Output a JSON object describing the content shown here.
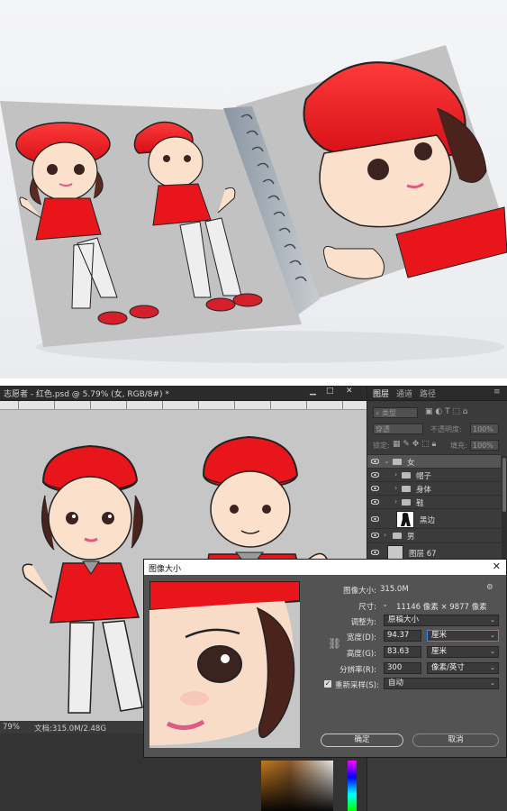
{
  "photoshop": {
    "document_tab": "志愿者 - 红色.psd @ 5.79% (女, RGB/8#) *",
    "status": {
      "zoom": "79%",
      "doc_info": "文档:315.0M/2.48G"
    },
    "panel_tabs": [
      "图层",
      "通道",
      "路径"
    ],
    "layers_panel": {
      "filter_placeholder": "类型",
      "blend_mode": "穿透",
      "opacity_label": "不透明度:",
      "opacity_value": "100%",
      "lock_label": "锁定:",
      "fill_label": "填充:",
      "fill_value": "100%",
      "layers": [
        {
          "name": "女",
          "type": "group",
          "expanded": true,
          "indent": 0
        },
        {
          "name": "帽子",
          "type": "group",
          "expanded": false,
          "indent": 1
        },
        {
          "name": "身体",
          "type": "group",
          "expanded": false,
          "indent": 1
        },
        {
          "name": "鞋",
          "type": "group",
          "expanded": false,
          "indent": 1
        },
        {
          "name": "黑边",
          "type": "layer",
          "indent": 1
        },
        {
          "name": "男",
          "type": "group",
          "expanded": false,
          "indent": 0
        },
        {
          "name": "图层 67",
          "type": "layer",
          "indent": 0
        }
      ]
    },
    "image_size_dialog": {
      "title": "图像大小",
      "close_icon": "close-icon",
      "image_size_label": "图像大小:",
      "image_size_value": "315.0M",
      "dimensions_label": "尺寸:",
      "dimensions_value": "11146 像素 × 9877 像素",
      "fit_label": "调整为:",
      "fit_value": "原稿大小",
      "width_label": "宽度(D):",
      "width_value": "94.37",
      "width_unit": "厘米",
      "height_label": "高度(G):",
      "height_value": "83.63",
      "height_unit": "厘米",
      "resolution_label": "分辨率(R):",
      "resolution_value": "300",
      "resolution_unit": "像素/英寸",
      "resample_label": "重新采样(S):",
      "resample_checked": true,
      "resample_value": "自动",
      "ok_label": "确定",
      "cancel_label": "取消"
    }
  },
  "colors": {
    "cap_red": "#e8151b",
    "shirt_red": "#e8151b",
    "ps_dark": "#3c3c3c",
    "dialog_bg": "#535353"
  }
}
